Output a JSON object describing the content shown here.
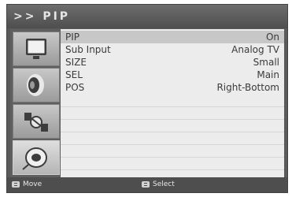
{
  "window": {
    "title": ">> PIP"
  },
  "sidebar": {
    "items": [
      {
        "name": "display",
        "icon": "monitor-icon",
        "active": false
      },
      {
        "name": "sound",
        "icon": "speaker-icon",
        "active": false
      },
      {
        "name": "channel",
        "icon": "satellite-icon",
        "active": false
      },
      {
        "name": "setup",
        "icon": "disc-icon",
        "active": true
      }
    ]
  },
  "menu": {
    "rows": [
      {
        "label": "PIP",
        "value": "On",
        "selected": true
      },
      {
        "label": "Sub Input",
        "value": "Analog TV",
        "selected": false
      },
      {
        "label": "SIZE",
        "value": "Small",
        "selected": false
      },
      {
        "label": "SEL",
        "value": "Main",
        "selected": false
      },
      {
        "label": "POS",
        "value": "Right-Bottom",
        "selected": false
      }
    ]
  },
  "footer": {
    "move_label": "Move",
    "select_label": "Select"
  },
  "colors": {
    "frame": "#5a5a5a",
    "content_bg": "#ececec",
    "selected_row": "#c7c7c7"
  }
}
